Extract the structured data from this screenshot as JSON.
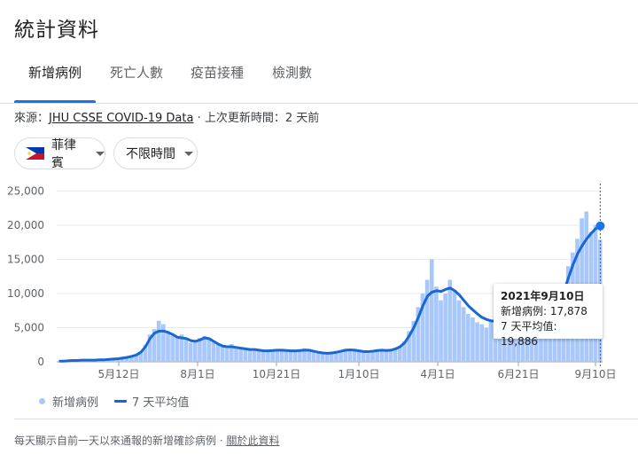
{
  "title": "統計資料",
  "tabs": [
    {
      "label": "新增病例",
      "active": true
    },
    {
      "label": "死亡人數",
      "active": false
    },
    {
      "label": "疫苗接種",
      "active": false
    },
    {
      "label": "檢測數",
      "active": false
    }
  ],
  "source": {
    "prefix": "來源：",
    "link": "JHU CSSE COVID-19 Data",
    "suffix": "· 上次更新時間：2 天前"
  },
  "filters": {
    "region": {
      "label": "菲律賓",
      "flag_icon": "philippines-flag-icon"
    },
    "time_range": {
      "label": "不限時間"
    }
  },
  "tooltip": {
    "date": "2021年9月10日",
    "new_cases": "新增病例: 17,878",
    "avg7": "7 天平均值: 19,886"
  },
  "legend": {
    "bars_label": "新增病例",
    "line_label": "7 天平均值"
  },
  "footer": {
    "text": "每天顯示自前一天以來通報的新增確診病例 ·",
    "link": "關於此資料"
  },
  "colors": {
    "accent": "#1a73e8",
    "bar": "#a8c7fa",
    "line": "#1967d2"
  },
  "chart_data": {
    "type": "bar",
    "x_ticks": [
      "5月12日",
      "8月1日",
      "10月21日",
      "1月10日",
      "4月1日",
      "6月21日",
      "9月10日"
    ],
    "y_ticks": [
      "0",
      "5,000",
      "10,000",
      "15,000",
      "20,000",
      "25,000"
    ],
    "ylim": [
      0,
      27000
    ],
    "grid": true,
    "legend_position": "bottom-left",
    "series": [
      {
        "name": "新增病例",
        "type": "bar",
        "values": [
          0,
          50,
          100,
          150,
          200,
          250,
          300,
          200,
          250,
          300,
          350,
          300,
          400,
          500,
          600,
          700,
          800,
          1000,
          1500,
          2500,
          4000,
          4800,
          6000,
          5500,
          4500,
          3800,
          3500,
          4000,
          3200,
          2800,
          3000,
          3500,
          3800,
          3500,
          3000,
          2500,
          2200,
          2000,
          2600,
          2200,
          2000,
          1800,
          1700,
          1900,
          1600,
          1500,
          1500,
          1700,
          1800,
          1700,
          1600,
          1500,
          1500,
          1700,
          2000,
          1800,
          1500,
          1300,
          1200,
          1200,
          1300,
          1500,
          1700,
          1900,
          1800,
          1700,
          1500,
          1400,
          1500,
          1600,
          1800,
          1700,
          1600,
          1700,
          2000,
          2300,
          3000,
          4500,
          6000,
          8000,
          10000,
          12000,
          15000,
          11000,
          9000,
          10000,
          12000,
          10500,
          9000,
          8000,
          7000,
          6500,
          5800,
          5500,
          5000,
          6000,
          5500,
          6000,
          5800,
          6500,
          6800,
          7000,
          6500,
          6000,
          5800,
          6200,
          6500,
          6800,
          7500,
          8000,
          9000,
          11000,
          14000,
          16000,
          18000,
          21000,
          22000,
          19000,
          20000,
          17878
        ]
      },
      {
        "name": "7 天平均值",
        "type": "line",
        "values": [
          100,
          100,
          150,
          200,
          200,
          250,
          250,
          250,
          250,
          300,
          300,
          350,
          400,
          450,
          550,
          650,
          800,
          1000,
          1400,
          2200,
          3400,
          4200,
          4500,
          4500,
          4300,
          4000,
          3600,
          3500,
          3400,
          3100,
          3000,
          3200,
          3500,
          3400,
          3000,
          2600,
          2300,
          2200,
          2200,
          2100,
          2000,
          1900,
          1800,
          1800,
          1700,
          1600,
          1600,
          1650,
          1700,
          1700,
          1650,
          1600,
          1600,
          1650,
          1700,
          1700,
          1550,
          1400,
          1300,
          1250,
          1300,
          1400,
          1550,
          1700,
          1750,
          1700,
          1600,
          1500,
          1500,
          1550,
          1650,
          1700,
          1650,
          1700,
          1900,
          2200,
          2800,
          3800,
          5000,
          6500,
          8200,
          9600,
          10200,
          10400,
          10300,
          10600,
          10800,
          10400,
          9800,
          9000,
          8200,
          7600,
          7000,
          6500,
          6200,
          6000,
          5900,
          6000,
          6100,
          6300,
          6500,
          6600,
          6500,
          6300,
          6200,
          6300,
          6500,
          6800,
          7300,
          8000,
          8900,
          10300,
          12300,
          14200,
          15800,
          17000,
          18000,
          18800,
          19500,
          19886
        ]
      }
    ],
    "highlight": {
      "date": "2021年9月10日",
      "new_cases": 17878,
      "avg7": 19886
    }
  }
}
